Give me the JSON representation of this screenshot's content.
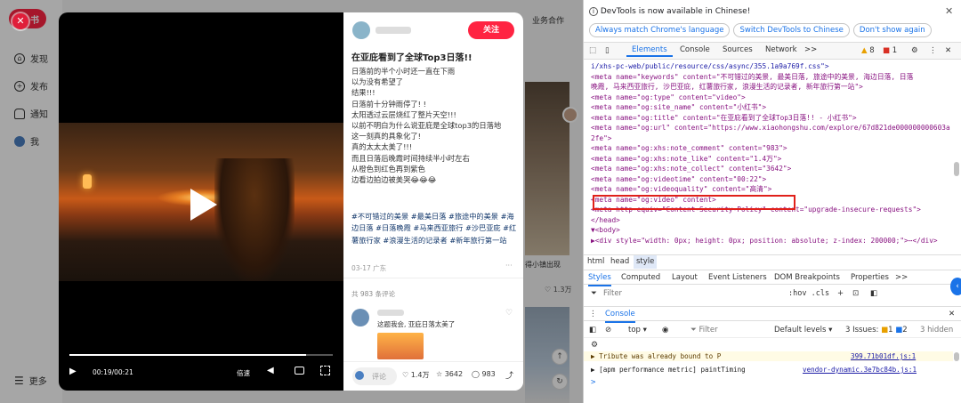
{
  "page": {
    "brand": "书",
    "top_link": "业务合作"
  },
  "sidenav": {
    "items": [
      {
        "label": "发现",
        "icon": "home-icon"
      },
      {
        "label": "发布",
        "icon": "plus-icon"
      },
      {
        "label": "通知",
        "icon": "bell-icon"
      },
      {
        "label": "我",
        "icon": "avatar-icon"
      }
    ],
    "more": "更多"
  },
  "video": {
    "time": "00:19/00:21",
    "speed": "倍速",
    "progress": 0.9
  },
  "bg": {
    "caption": "得小镇出现",
    "likes": "1.3万"
  },
  "note": {
    "follow": "关注",
    "title": "在亚庇看到了全球Top3日落!!",
    "body": [
      "日落前的半个小时还一直在下雨",
      "以为没有希望了",
      "结果!!!",
      "日落前十分钟雨停了! !",
      "太阳透过云层烧红了整片天空!!!",
      "以前不明白为什么说亚庇是全球top3的日落地",
      "这一刻真的具象化了!",
      "真的太太太美了!!!",
      "而且日落后晚霞时间持续半小时左右",
      "从橙色到红色再到紫色",
      "边看边拍边被美哭😂😂😂"
    ],
    "dot": ".",
    "tags": "#不可错过的美景 #最美日落 #旅途中的美景 #海边日落 #日落晚霞 #马来西亚旅行 #沙巴亚庇 #红薯旅行家 #浪漫生活的记录者 #新年旅行第一站",
    "meta": "03-17 广东",
    "comments_count": "共 983 条评论",
    "comment_text": "这题我会, 亚庇日落太美了",
    "comment_btn": "评论",
    "likes": "1.4万",
    "stars": "3642",
    "comments": "983"
  },
  "devtools": {
    "banner": "DevTools is now available in Chinese!",
    "banner_buttons": [
      "Always match Chrome's language",
      "Switch DevTools to Chinese",
      "Don't show again"
    ],
    "tabs": [
      "Elements",
      "Console",
      "Sources",
      "Network",
      ">>"
    ],
    "warn_count": "8",
    "err_count": "1",
    "code": [
      {
        "tag": "",
        "attrs": "",
        "raw": "i/xhs-pc-web/public/resource/css/async/355.1a9a769f.css\">"
      },
      {
        "raw": "<meta name=\"keywords\" content=\"不可错过的美景, 最美日落, 旅途中的美景, 海边日落, 日落"
      },
      {
        "raw": "晚霞, 马来西亚旅行, 沙巴亚庇, 红薯旅行家, 浪漫生活的记录者, 新年旅行第一站\">"
      },
      {
        "raw": "<meta name=\"og:type\" content=\"video\">"
      },
      {
        "raw": "<meta name=\"og:site_name\" content=\"小红书\">"
      },
      {
        "raw": "<meta name=\"og:title\" content=\"在亚庇看到了全球Top3日落!! - 小红书\">"
      },
      {
        "raw": "<meta name=\"og:url\" content=\"https://www.xiaohongshu.com/explore/67d821de000000000603a"
      },
      {
        "raw": "2fe\">"
      },
      {
        "raw": "<meta name=\"og:xhs:note_comment\" content=\"983\">"
      },
      {
        "raw": "<meta name=\"og:xhs:note_like\" content=\"1.4万\">"
      },
      {
        "raw": "<meta name=\"og:xhs:note_collect\" content=\"3642\">"
      },
      {
        "raw": "<meta name=\"og:videotime\" content=\"00:22\">"
      },
      {
        "raw": "<meta name=\"og:videoquality\" content=\"高清\">"
      },
      {
        "raw": "<meta name=\"og:video\" content>"
      },
      {
        "raw": "<meta http-equiv=\"Content-Security-Policy\" content=\"upgrade-insecure-requests\">"
      },
      {
        "raw": "</head>"
      },
      {
        "raw": "▼<body>"
      },
      {
        "raw": "▶<div style=\"width: 0px; height: 0px; position: absolute; z-index: 200000;\">⋯</div>"
      }
    ],
    "breadcrumb": [
      "html",
      "head",
      "style"
    ],
    "style_tabs": [
      "Styles",
      "Computed",
      "Layout",
      "Event Listeners",
      "DOM Breakpoints",
      "Properties",
      ">>"
    ],
    "filter_placeholder": "Filter",
    "hov_cls": ":hov .cls",
    "console_label": "Console",
    "console_top": "top",
    "console_filter": "Filter",
    "levels": "Default levels",
    "issues": "3 Issues:",
    "issue_w": "1",
    "issue_i": "2",
    "hidden": "3 hidden",
    "log1": "▶ Tribute was already bound to P",
    "log1_src": "399.71b01df.js:1",
    "log2": "▶ [apm performance metric] paintTiming",
    "log2_src": "vendor-dynamic.3e7bc84b.js:1",
    "prompt": ">"
  }
}
